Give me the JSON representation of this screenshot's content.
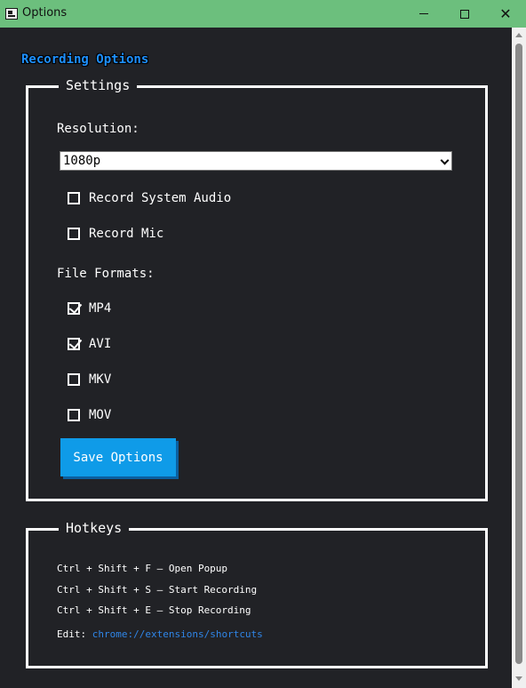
{
  "window": {
    "title": "Options",
    "close_glyph": "✕"
  },
  "heading": "Recording Options",
  "settings": {
    "legend": "Settings",
    "resolution_label": "Resolution:",
    "resolution_value": "1080p",
    "audio": [
      {
        "label": "Record System Audio",
        "checked": false
      },
      {
        "label": "Record Mic",
        "checked": false
      }
    ],
    "formats_label": "File Formats:",
    "formats": [
      {
        "label": "MP4",
        "checked": true
      },
      {
        "label": "AVI",
        "checked": true
      },
      {
        "label": "MKV",
        "checked": false
      },
      {
        "label": "MOV",
        "checked": false
      }
    ],
    "save_label": "Save Options"
  },
  "hotkeys": {
    "legend": "Hotkeys",
    "items": [
      "Ctrl + Shift + F — Open Popup",
      "Ctrl + Shift + S — Start Recording",
      "Ctrl + Shift + E — Stop Recording"
    ],
    "edit_label": "Edit:",
    "edit_link": "chrome://extensions/shortcuts"
  },
  "colors": {
    "titlebar": "#6cbf7d",
    "background": "#212226",
    "accent": "#0f9be8",
    "heading": "#1e90ff",
    "link": "#2f86e8"
  },
  "icons": {
    "app": "app-icon",
    "minimize": "minimize-icon",
    "maximize": "maximize-icon",
    "close": "close-icon"
  }
}
